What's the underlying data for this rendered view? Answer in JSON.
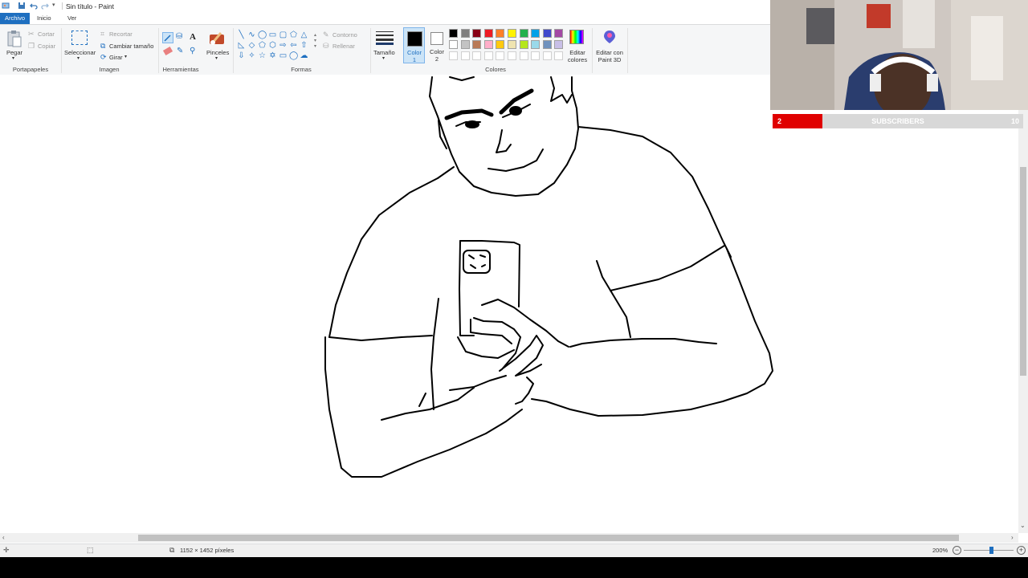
{
  "window": {
    "title": "Sin título - Paint"
  },
  "menu": {
    "tabs": [
      "Archivo",
      "Inicio",
      "Ver"
    ]
  },
  "ribbon": {
    "clipboard": {
      "paste": "Pegar",
      "cut": "Cortar",
      "copy": "Copiar",
      "group": "Portapapeles"
    },
    "image": {
      "select": "Seleccionar",
      "crop": "Recortar",
      "resize": "Cambiar tamaño",
      "rotate": "Girar",
      "group": "Imagen"
    },
    "tools": {
      "group": "Herramientas"
    },
    "brushes": {
      "label": "Pinceles"
    },
    "shapes": {
      "outline": "Contorno",
      "fill": "Rellenar",
      "group": "Formas"
    },
    "size": {
      "label": "Tamaño"
    },
    "colors": {
      "color1": "Color 1",
      "color2": "Color 2",
      "edit": "Editar colores",
      "paint3d": "Editar con Paint 3D",
      "group": "Colores",
      "color1_value": "#000000",
      "color2_value": "#ffffff",
      "palette_row1": [
        "#000000",
        "#7f7f7f",
        "#880015",
        "#ed1c24",
        "#ff7f27",
        "#fff200",
        "#22b14c",
        "#00a2e8",
        "#3f48cc",
        "#a349a4"
      ],
      "palette_row2": [
        "#ffffff",
        "#c3c3c3",
        "#b97a57",
        "#ffaec9",
        "#ffc90e",
        "#efe4b0",
        "#b5e61d",
        "#99d9ea",
        "#7092be",
        "#c8bfe7"
      ]
    }
  },
  "statusbar": {
    "dimensions": "1152 × 1452 píxeles",
    "zoom": "200%"
  },
  "overlay": {
    "subscribers_label": "SUBSCRIBERS",
    "current": "2",
    "goal": "10",
    "progress": 0.2
  }
}
